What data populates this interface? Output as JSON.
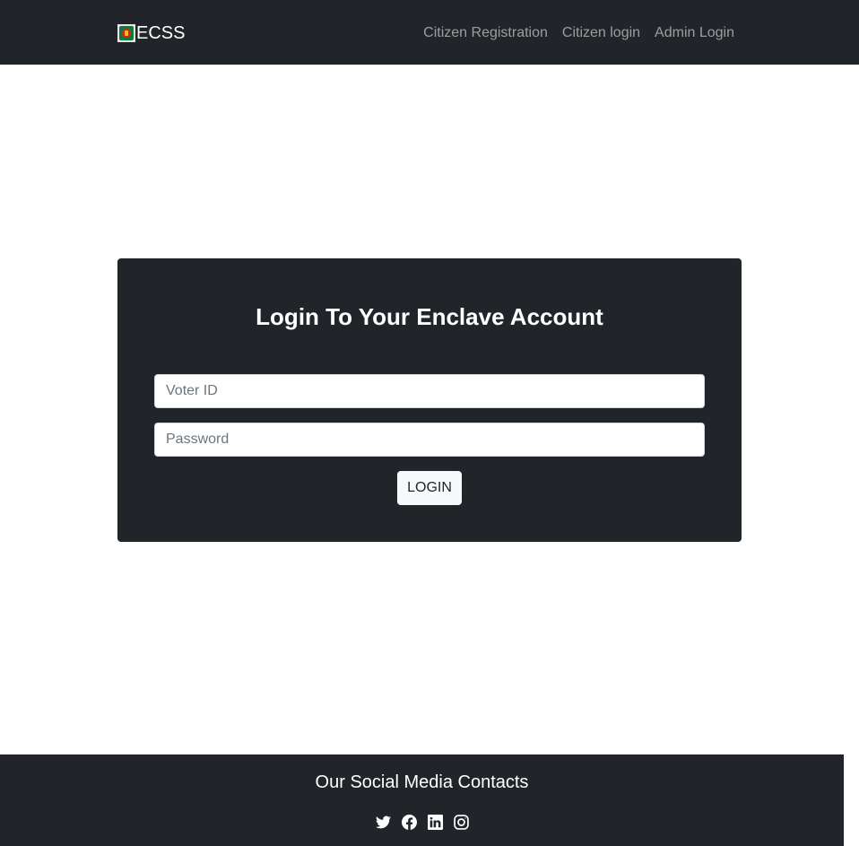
{
  "navbar": {
    "brand": "ECSS",
    "links": [
      "Citizen Registration",
      "Citizen login",
      "Admin Login"
    ]
  },
  "login": {
    "title": "Login To Your Enclave Account",
    "voter_placeholder": "Voter ID",
    "password_placeholder": "Password",
    "button_label": "LOGIN"
  },
  "footer": {
    "title": "Our Social Media Contacts",
    "icons": [
      "twitter-icon",
      "facebook-icon",
      "linkedin-icon",
      "instagram-icon"
    ]
  },
  "colors": {
    "dark": "#212529",
    "nav_link": "rgba(255,255,255,0.55)",
    "button_bg": "#f8f9fa"
  }
}
